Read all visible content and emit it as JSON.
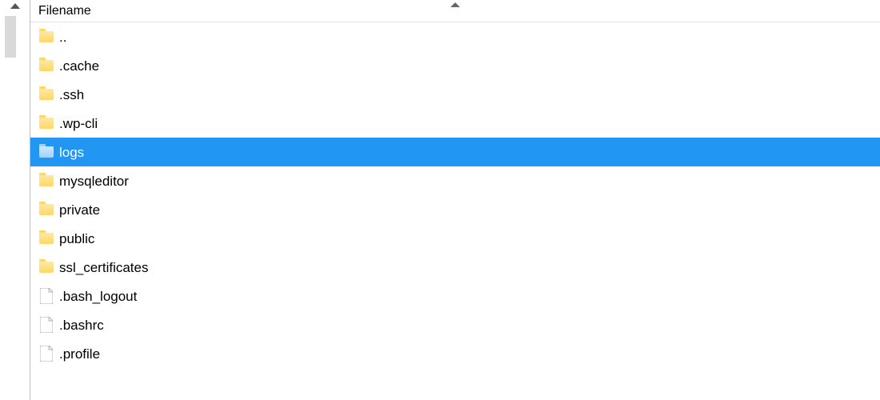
{
  "columnHeader": "Filename",
  "items": [
    {
      "name": "..",
      "type": "folder",
      "selected": false
    },
    {
      "name": ".cache",
      "type": "folder",
      "selected": false
    },
    {
      "name": ".ssh",
      "type": "folder",
      "selected": false
    },
    {
      "name": ".wp-cli",
      "type": "folder",
      "selected": false
    },
    {
      "name": "logs",
      "type": "folder",
      "selected": true
    },
    {
      "name": "mysqleditor",
      "type": "folder",
      "selected": false
    },
    {
      "name": "private",
      "type": "folder",
      "selected": false
    },
    {
      "name": "public",
      "type": "folder",
      "selected": false
    },
    {
      "name": "ssl_certificates",
      "type": "folder",
      "selected": false
    },
    {
      "name": ".bash_logout",
      "type": "file",
      "selected": false
    },
    {
      "name": ".bashrc",
      "type": "file",
      "selected": false
    },
    {
      "name": ".profile",
      "type": "file",
      "selected": false
    }
  ]
}
